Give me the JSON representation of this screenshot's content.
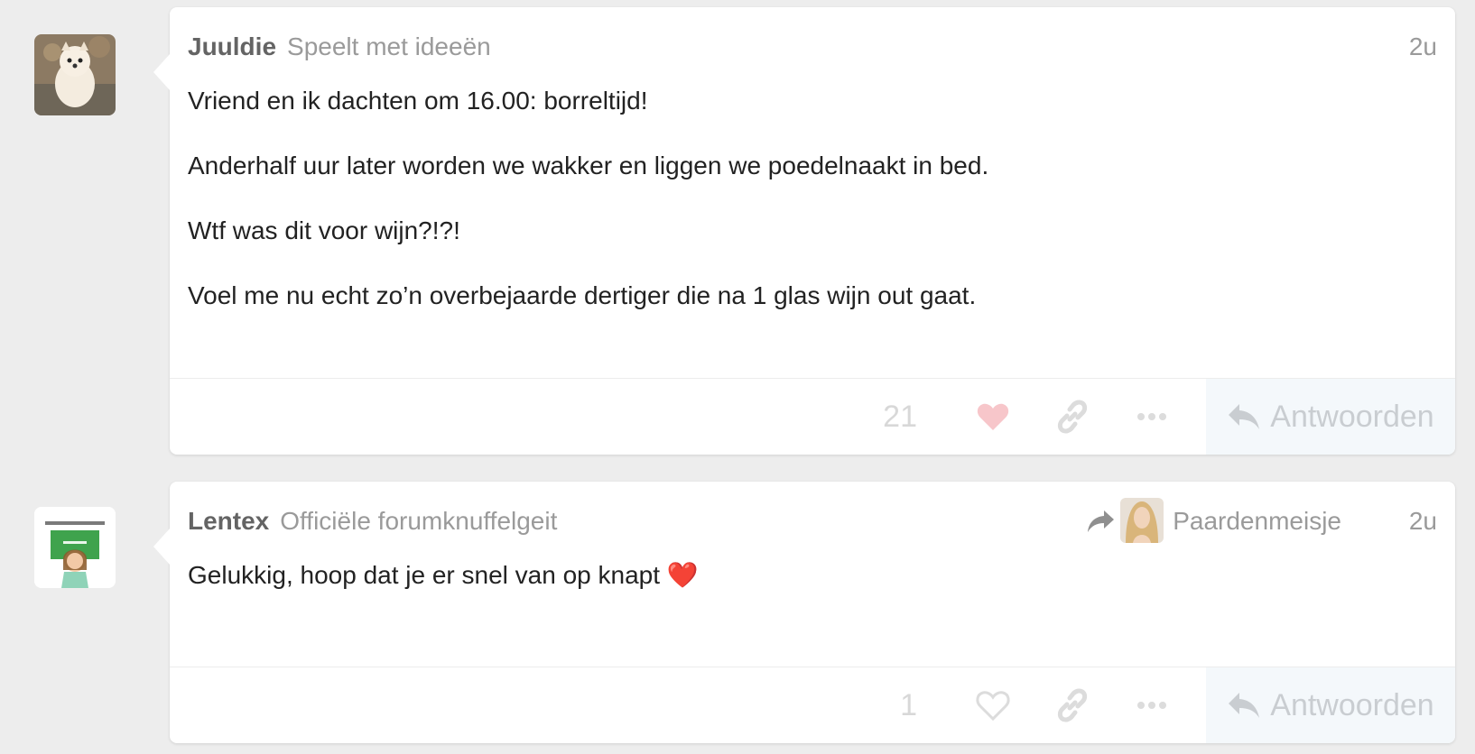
{
  "posts": [
    {
      "username": "Juuldie",
      "user_title": "Speelt met ideeën",
      "age": "2u",
      "avatar_icon": "pomeranian-dog-avatar",
      "paragraphs": [
        "Vriend en ik dachten om 16.00: borreltijd!",
        "Anderhalf uur later worden we wakker en liggen we poedelnaakt in bed.",
        "Wtf was dit voor wijn?!?!",
        "Voel me nu echt zo’n overbejaarde dertiger die na 1 glas wijn out gaat."
      ],
      "like_count": "21",
      "liked": true,
      "reply_label": "Antwoorden"
    },
    {
      "username": "Lentex",
      "user_title": "Officiële forumknuffelgeit",
      "age": "2u",
      "avatar_icon": "teacher-badge-avatar",
      "reply_to": {
        "name": "Paardenmeisje",
        "icon": "share-arrow-icon"
      },
      "paragraphs": [
        "Gelukkig, hoop dat je er snel van op knapt ❤️"
      ],
      "like_count": "1",
      "liked": false,
      "reply_label": "Antwoorden"
    }
  ],
  "colors": {
    "background": "#ededed",
    "liked_heart": "#f7c6ca",
    "icon_muted": "#dcdcdc",
    "reply_button_bg": "#f4f8fb"
  }
}
